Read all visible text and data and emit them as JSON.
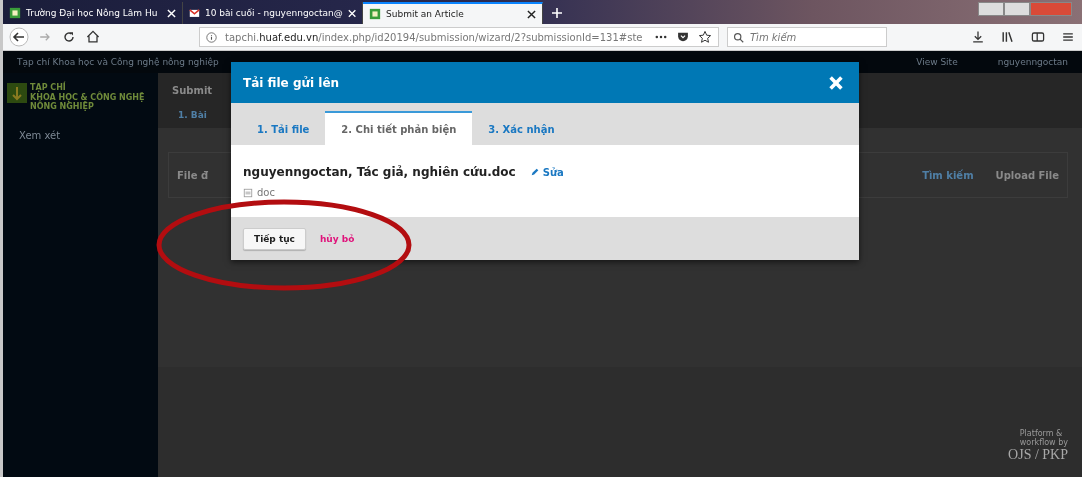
{
  "browser": {
    "tabs": [
      {
        "title": "Trường Đại học Nông Lâm Hu",
        "selected": false
      },
      {
        "title": "10 bài cuối - nguyenngoctan@",
        "selected": false
      },
      {
        "title": "Submit an Article",
        "selected": true
      }
    ],
    "url": {
      "host": "tapchi.",
      "domain": "huaf.edu.vn",
      "path": "/index.php/id20194/submission/wizard/2?submissionId=131#ste"
    },
    "search": {
      "placeholder": "Tìm kiếm"
    }
  },
  "site": {
    "journal_title": "Tạp chí Khoa học và Công nghệ nông nghiệp",
    "top_links": [
      "View Site",
      "nguyenngoctan"
    ],
    "logo_lines": [
      "TẠP CHÍ",
      "KHOA HỌC & CÔNG NGHỆ",
      "NÔNG NGHIỆP"
    ],
    "sidebar": [
      {
        "label": "Xem xét"
      }
    ],
    "page_title": "Submit",
    "step_tab": "1. Bài",
    "section_title": "File đ",
    "section_actions": [
      "Tìm kiếm",
      "Upload File"
    ],
    "footer": {
      "line1": "Platform &",
      "line2": "workflow by",
      "brand": "OJS / PKP"
    }
  },
  "modal": {
    "title": "Tải file gửi lên",
    "tabs": [
      {
        "label": "1. Tải file",
        "selected": false
      },
      {
        "label": "2. Chi tiết phản biện",
        "selected": true
      },
      {
        "label": "3. Xác nhận",
        "selected": false
      }
    ],
    "file_name": "nguyenngoctan, Tác giả, nghiên cứu.doc",
    "edit_link": "Sửa",
    "file_type": "doc",
    "buttons": [
      {
        "label": "Tiếp tục",
        "kind": "primary"
      },
      {
        "label": "hủy bỏ",
        "kind": "cancel"
      }
    ]
  }
}
